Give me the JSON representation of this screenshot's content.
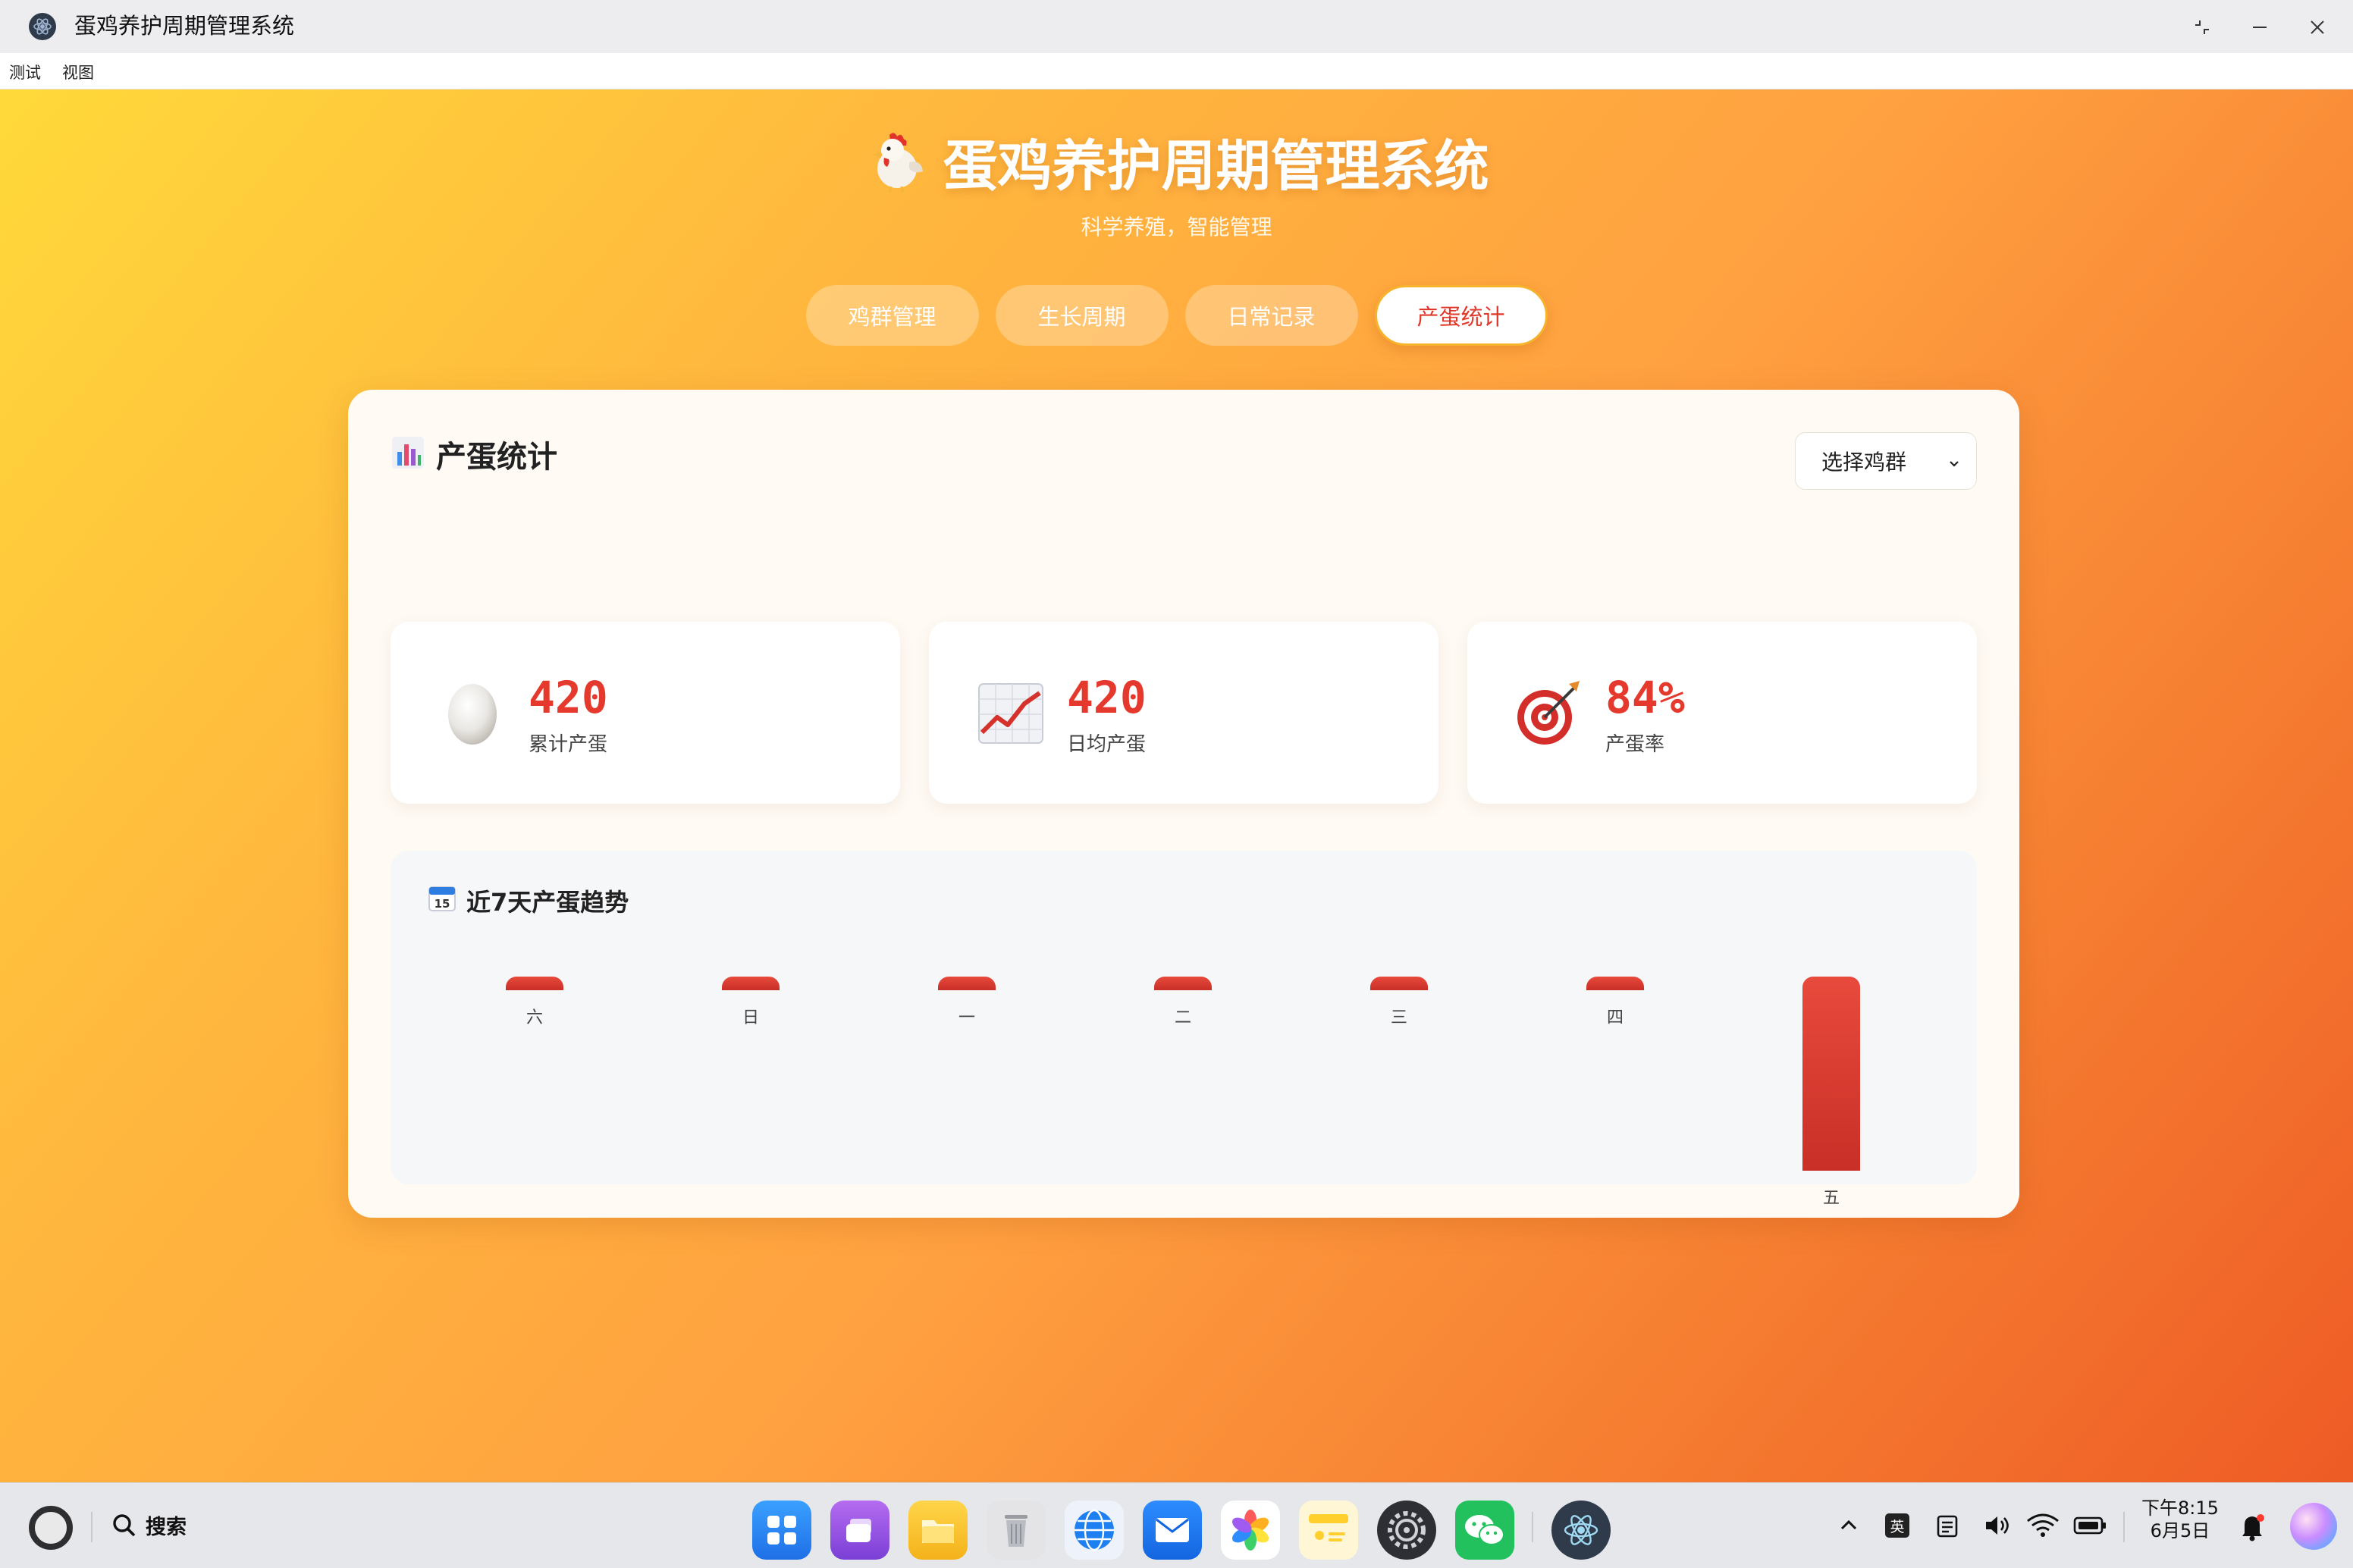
{
  "window": {
    "title": "蛋鸡养护周期管理系统",
    "controls": [
      "restore-icon",
      "minimize-icon",
      "close-icon"
    ]
  },
  "menu": {
    "items": [
      "测试",
      "视图"
    ]
  },
  "hero": {
    "icon": "rooster-emoji",
    "title": "蛋鸡养护周期管理系统",
    "subtitle": "科学养殖，智能管理"
  },
  "tabs": [
    {
      "label": "鸡群管理",
      "active": false
    },
    {
      "label": "生长周期",
      "active": false
    },
    {
      "label": "日常记录",
      "active": false
    },
    {
      "label": "产蛋统计",
      "active": true
    }
  ],
  "panel": {
    "title": "产蛋统计",
    "title_icon": "bar-chart-icon",
    "select": {
      "value": "选择鸡群"
    }
  },
  "stats": [
    {
      "icon": "egg-icon",
      "value": "420",
      "label": "累计产蛋"
    },
    {
      "icon": "trend-chart-icon",
      "value": "420",
      "label": "日均产蛋"
    },
    {
      "icon": "target-icon",
      "value": "84%",
      "label": "产蛋率"
    }
  ],
  "chart_data": {
    "type": "bar",
    "title": "近7天产蛋趋势",
    "categories": [
      "六",
      "日",
      "一",
      "二",
      "三",
      "四",
      "五"
    ],
    "values": [
      0,
      0,
      0,
      0,
      0,
      0,
      420
    ],
    "xlabel": "",
    "ylabel": "",
    "bar_color": "#d93a2f",
    "grid": false,
    "legend": "none"
  },
  "taskbar": {
    "search_label": "搜索",
    "dock": [
      "launcher-icon",
      "multitask-icon",
      "files-icon",
      "trash-icon",
      "browser-icon",
      "mail-icon",
      "photos-icon",
      "notes-icon",
      "settings-icon",
      "wechat-icon",
      "electron-app-icon"
    ],
    "tray": [
      "chevron-up-icon",
      "ime-icon",
      "clipboard-icon",
      "volume-icon",
      "wifi-icon",
      "battery-icon"
    ],
    "ime_label": "英",
    "time": "下午8:15",
    "date": "6月5日"
  },
  "colors": {
    "accent": "#e5392d",
    "gradient_start": "#ffd93a",
    "gradient_end": "#ee5b25",
    "tab_active_border": "#f7b32b"
  }
}
